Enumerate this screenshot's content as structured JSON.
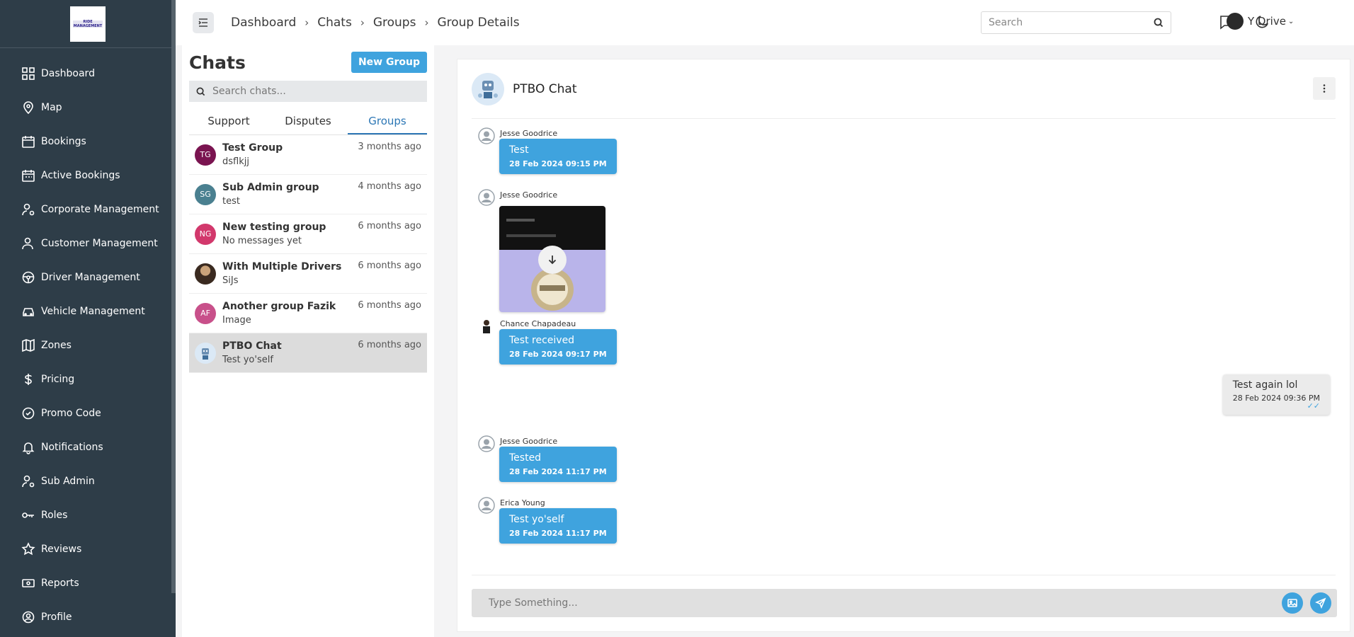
{
  "sidebar": {
    "logo_text": "RIDE MANAGEMENT",
    "items": [
      {
        "label": "Dashboard",
        "icon": "grid-icon"
      },
      {
        "label": "Map",
        "icon": "map-pin-icon"
      },
      {
        "label": "Bookings",
        "icon": "calendar-icon"
      },
      {
        "label": "Active Bookings",
        "icon": "calendar-check-icon"
      },
      {
        "label": "Corporate Management",
        "icon": "user-gear-icon"
      },
      {
        "label": "Customer Management",
        "icon": "user-icon"
      },
      {
        "label": "Driver Management",
        "icon": "steering-wheel-icon"
      },
      {
        "label": "Vehicle Management",
        "icon": "car-icon"
      },
      {
        "label": "Zones",
        "icon": "map-icon"
      },
      {
        "label": "Pricing",
        "icon": "dollar-icon"
      },
      {
        "label": "Promo Code",
        "icon": "badge-check-icon"
      },
      {
        "label": "Notifications",
        "icon": "bell-icon"
      },
      {
        "label": "Sub Admin",
        "icon": "user-cog-icon"
      },
      {
        "label": "Roles",
        "icon": "key-icon"
      },
      {
        "label": "Reviews",
        "icon": "star-icon"
      },
      {
        "label": "Reports",
        "icon": "money-icon"
      },
      {
        "label": "Profile",
        "icon": "user-circle-icon"
      }
    ]
  },
  "breadcrumb": [
    "Dashboard",
    "Chats",
    "Groups",
    "Group Details"
  ],
  "topbar": {
    "search_placeholder": "Search",
    "user_name": "Y Drive"
  },
  "chats": {
    "title": "Chats",
    "new_group_label": "New Group",
    "search_placeholder": "Search chats...",
    "tabs": [
      {
        "label": "Support",
        "active": false
      },
      {
        "label": "Disputes",
        "active": false
      },
      {
        "label": "Groups",
        "active": true
      }
    ],
    "items": [
      {
        "initials": "TG",
        "name": "Test Group",
        "last": "dsflkjj",
        "time": "3 months ago",
        "color": "#7a1450"
      },
      {
        "initials": "SG",
        "name": "Sub Admin group",
        "last": "test",
        "time": "4 months ago",
        "color": "#4a8090"
      },
      {
        "initials": "NG",
        "name": "New testing group",
        "last": "No messages yet",
        "time": "6 months ago",
        "color": "#d2386c"
      },
      {
        "initials": "",
        "name": "With Multiple Drivers",
        "last": "SiJs",
        "time": "6 months ago",
        "color": "#3a2a20"
      },
      {
        "initials": "AF",
        "name": "Another group Fazik",
        "last": "Image",
        "time": "6 months ago",
        "color": "#c8508a"
      },
      {
        "initials": "",
        "name": "PTBO Chat",
        "last": "Test yo'self",
        "time": "6 months ago",
        "color": "#dbe9f6"
      }
    ]
  },
  "conversation": {
    "title": "PTBO Chat",
    "messages": [
      {
        "sender": "Jesse Goodrice",
        "text": "Test",
        "time": "28 Feb 2024 09:15 PM"
      },
      {
        "sender": "Jesse Goodrice",
        "type": "image"
      },
      {
        "sender": "Chance Chapadeau",
        "text": "Test received",
        "time": "28 Feb 2024 09:17 PM"
      },
      {
        "sender": "me",
        "text": "Test again lol",
        "time": "28 Feb 2024 09:36 PM",
        "status": "✓✓"
      },
      {
        "sender": "Jesse Goodrice",
        "text": "Tested",
        "time": "28 Feb 2024 11:17 PM"
      },
      {
        "sender": "Erica Young",
        "text": "Test yo'self",
        "time": "28 Feb 2024 11:17 PM"
      }
    ],
    "composer_placeholder": "Type Something..."
  },
  "colors": {
    "sidebar_bg": "#2e3d48",
    "accent": "#3fa3de",
    "active_tab": "#2c77b5"
  }
}
